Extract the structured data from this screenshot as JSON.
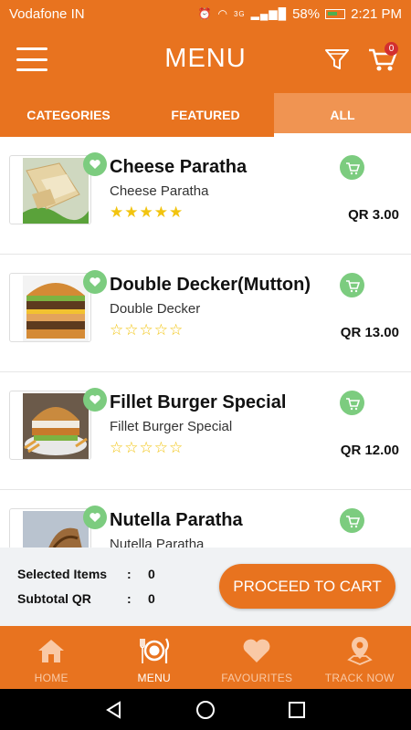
{
  "status_bar": {
    "carrier": "Vodafone IN",
    "network": "3G",
    "battery": "58%",
    "time": "2:21 PM"
  },
  "toolbar": {
    "title": "MENU",
    "cart_count": "0",
    "icons": [
      "hamburger-menu-icon",
      "filter-icon",
      "cart-icon"
    ]
  },
  "tabs": [
    {
      "label": "CATEGORIES",
      "active": false
    },
    {
      "label": "FEATURED",
      "active": false
    },
    {
      "label": "ALL",
      "active": true
    }
  ],
  "items": [
    {
      "name": "Cheese Paratha",
      "subtitle": "Cheese Paratha",
      "rating": 5,
      "price": "QR  3.00"
    },
    {
      "name": "Double Decker(Mutton)",
      "subtitle": "Double Decker",
      "rating": 0,
      "price": "QR  13.00"
    },
    {
      "name": "Fillet Burger Special",
      "subtitle": "Fillet Burger Special",
      "rating": 0,
      "price": "QR  12.00"
    },
    {
      "name": "Nutella Paratha",
      "subtitle": "Nutella Paratha",
      "rating": 0,
      "price": ""
    }
  ],
  "summary": {
    "selected_label": "Selected Items",
    "selected_value": "0",
    "subtotal_label": "Subtotal QR",
    "subtotal_value": "0",
    "colon": ":",
    "proceed_label": "PROCEED TO CART"
  },
  "bottom_nav": [
    {
      "label": "HOME",
      "icon": "home-icon",
      "active": false
    },
    {
      "label": "MENU",
      "icon": "plate-cutlery-icon",
      "active": true
    },
    {
      "label": "FAVOURITES",
      "icon": "heart-icon",
      "active": false
    },
    {
      "label": "TRACK NOW",
      "icon": "location-pin-icon",
      "active": false
    }
  ],
  "colors": {
    "brand_orange": "#e8731f",
    "active_tab": "#f09452",
    "green_badge": "#7ccc7f",
    "star": "#f2c40f",
    "summary_bg": "#f0f2f4"
  }
}
